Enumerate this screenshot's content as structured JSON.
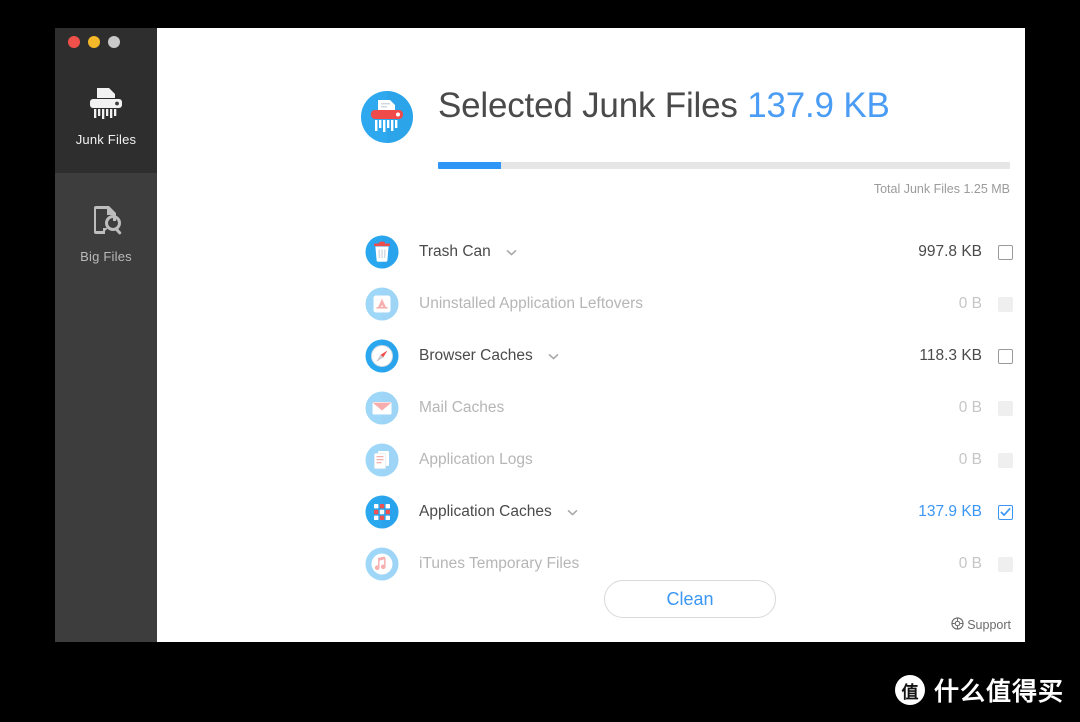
{
  "window": {
    "traffic_lights": [
      "close",
      "minimize",
      "maximize"
    ]
  },
  "sidebar": {
    "items": [
      {
        "label": "Junk Files",
        "icon": "shredder-icon",
        "active": true
      },
      {
        "label": "Big Files",
        "icon": "file-search-icon",
        "active": false
      }
    ]
  },
  "header": {
    "icon": "shredder-circle-icon",
    "title": "Selected Junk Files",
    "selected_size": "137.9 KB",
    "progress_percent": 11,
    "total_label": "Total Junk Files 1.25 MB"
  },
  "list": {
    "rows": [
      {
        "label": "Trash Can",
        "size": "997.8 KB",
        "icon": "trash-can-icon",
        "expandable": true,
        "state": "enabled",
        "checked": false
      },
      {
        "label": "Uninstalled Application Leftovers",
        "size": "0 B",
        "icon": "app-store-icon",
        "expandable": false,
        "state": "disabled",
        "checked": false
      },
      {
        "label": "Browser Caches",
        "size": "118.3 KB",
        "icon": "safari-compass-icon",
        "expandable": true,
        "state": "enabled",
        "checked": false
      },
      {
        "label": "Mail Caches",
        "size": "0 B",
        "icon": "mail-envelope-icon",
        "expandable": false,
        "state": "disabled",
        "checked": false
      },
      {
        "label": "Application Logs",
        "size": "0 B",
        "icon": "documents-stack-icon",
        "expandable": false,
        "state": "disabled",
        "checked": false
      },
      {
        "label": "Application Caches",
        "size": "137.9 KB",
        "icon": "launchpad-grid-icon",
        "expandable": true,
        "state": "selected",
        "checked": true
      },
      {
        "label": "iTunes Temporary Files",
        "size": "0 B",
        "icon": "itunes-note-icon",
        "expandable": false,
        "state": "disabled",
        "checked": false
      }
    ]
  },
  "footer": {
    "clean_label": "Clean",
    "support_label": "Support",
    "support_icon": "life-ring-icon"
  },
  "watermark": {
    "logo_char": "值",
    "text": "什么值得买"
  },
  "colors": {
    "accent_blue": "#3b97f3",
    "progress_blue": "#2f95f7",
    "sidebar_active": "#2e2e2e",
    "sidebar_inactive": "#3d3d3d",
    "text_dark": "#4a4a4a",
    "text_dim": "#b6b6b6"
  }
}
